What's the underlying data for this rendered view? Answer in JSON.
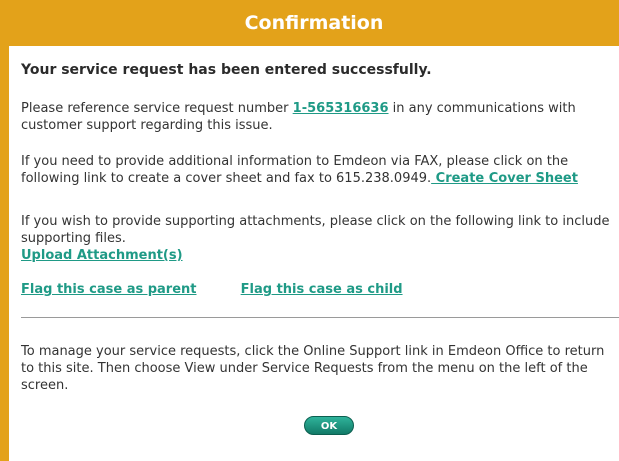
{
  "header": {
    "title": "Confirmation"
  },
  "main": {
    "headline": "Your service request has been entered successfully.",
    "reference": {
      "text_before": "Please reference service request number ",
      "request_number": "1-565316636",
      "text_after": " in any communications with customer support regarding this issue."
    },
    "fax": {
      "text": "If you need to provide additional information to Emdeon via FAX, please click on the following link to create a cover sheet and fax to 615.238.0949.",
      "link_label": " Create Cover Sheet"
    },
    "attachments": {
      "text": "If you wish to provide supporting attachments, please click on the following link to include supporting files.",
      "link_label": "Upload Attachment(s)"
    },
    "flags": {
      "parent_label": "Flag this case as parent",
      "child_label": "Flag this case as child"
    },
    "manage": {
      "text": "To manage your service requests, click the Online Support link in Emdeon Office to return to this site. Then choose View under Service Requests from the menu on the left of the screen."
    },
    "ok_label": "OK"
  }
}
